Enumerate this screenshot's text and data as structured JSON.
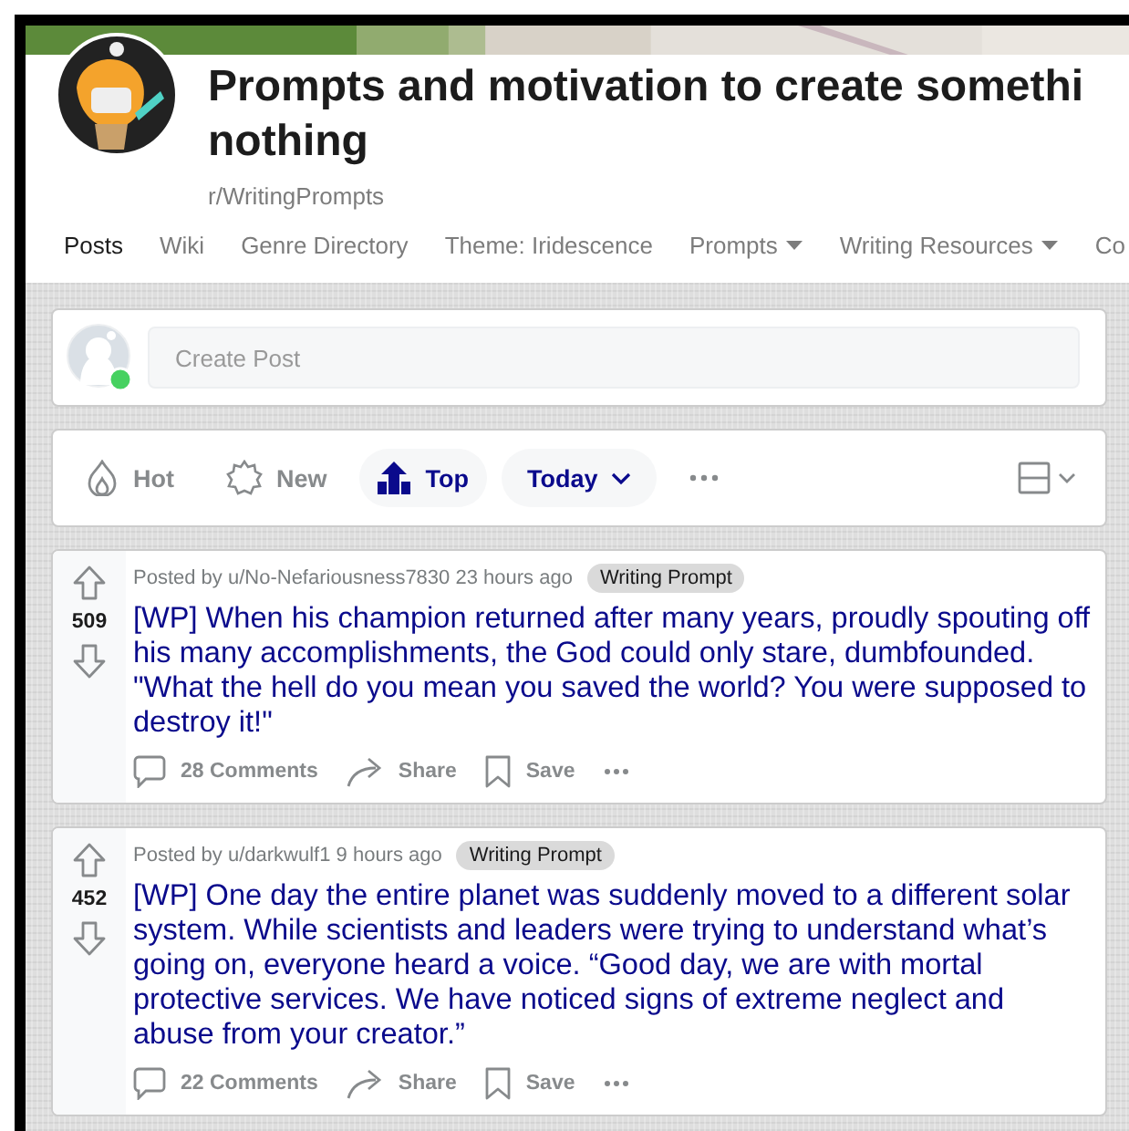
{
  "community": {
    "title_lines": [
      "Prompts and motivation to create somethi",
      "nothing"
    ],
    "name": "r/WritingPrompts"
  },
  "tabs": [
    {
      "label": "Posts",
      "selected": true,
      "has_menu": false
    },
    {
      "label": "Wiki",
      "selected": false,
      "has_menu": false
    },
    {
      "label": "Genre Directory",
      "selected": false,
      "has_menu": false
    },
    {
      "label": "Theme: Iridescence",
      "selected": false,
      "has_menu": false
    },
    {
      "label": "Prompts",
      "selected": false,
      "has_menu": true
    },
    {
      "label": "Writing Resources",
      "selected": false,
      "has_menu": true
    },
    {
      "label": "Co",
      "selected": false,
      "has_menu": false
    }
  ],
  "create_post": {
    "placeholder": "Create Post"
  },
  "sort_options": [
    {
      "kind": "hot",
      "label": "Hot",
      "selected": false
    },
    {
      "kind": "new",
      "label": "New",
      "selected": false
    },
    {
      "kind": "top",
      "label": "Top",
      "selected": true
    }
  ],
  "time_filter": {
    "label": "Today"
  },
  "posts": [
    {
      "byline": "Posted by u/No-Nefariousness7830 23 hours ago",
      "votes": "509",
      "flair": "Writing Prompt",
      "title": "[WP] When his champion returned after many years, proudly spouting off his many accomplishments, the God could only stare, dumbfounded. \"What the hell do you mean you saved the world? You were supposed to destroy it!\"",
      "comments": "28 Comments",
      "share": "Share",
      "save": "Save"
    },
    {
      "byline": "Posted by u/darkwulf1 9 hours ago",
      "votes": "452",
      "flair": "Writing Prompt",
      "title": "[WP] One day the entire planet was suddenly moved to a different solar system. While scientists and leaders were trying to understand what’s going on, everyone heard a voice. “Good day, we are with mortal protective services. We have noticed signs of extreme neglect and abuse from your creator.”",
      "comments": "22 Comments",
      "share": "Share",
      "save": "Save"
    }
  ]
}
